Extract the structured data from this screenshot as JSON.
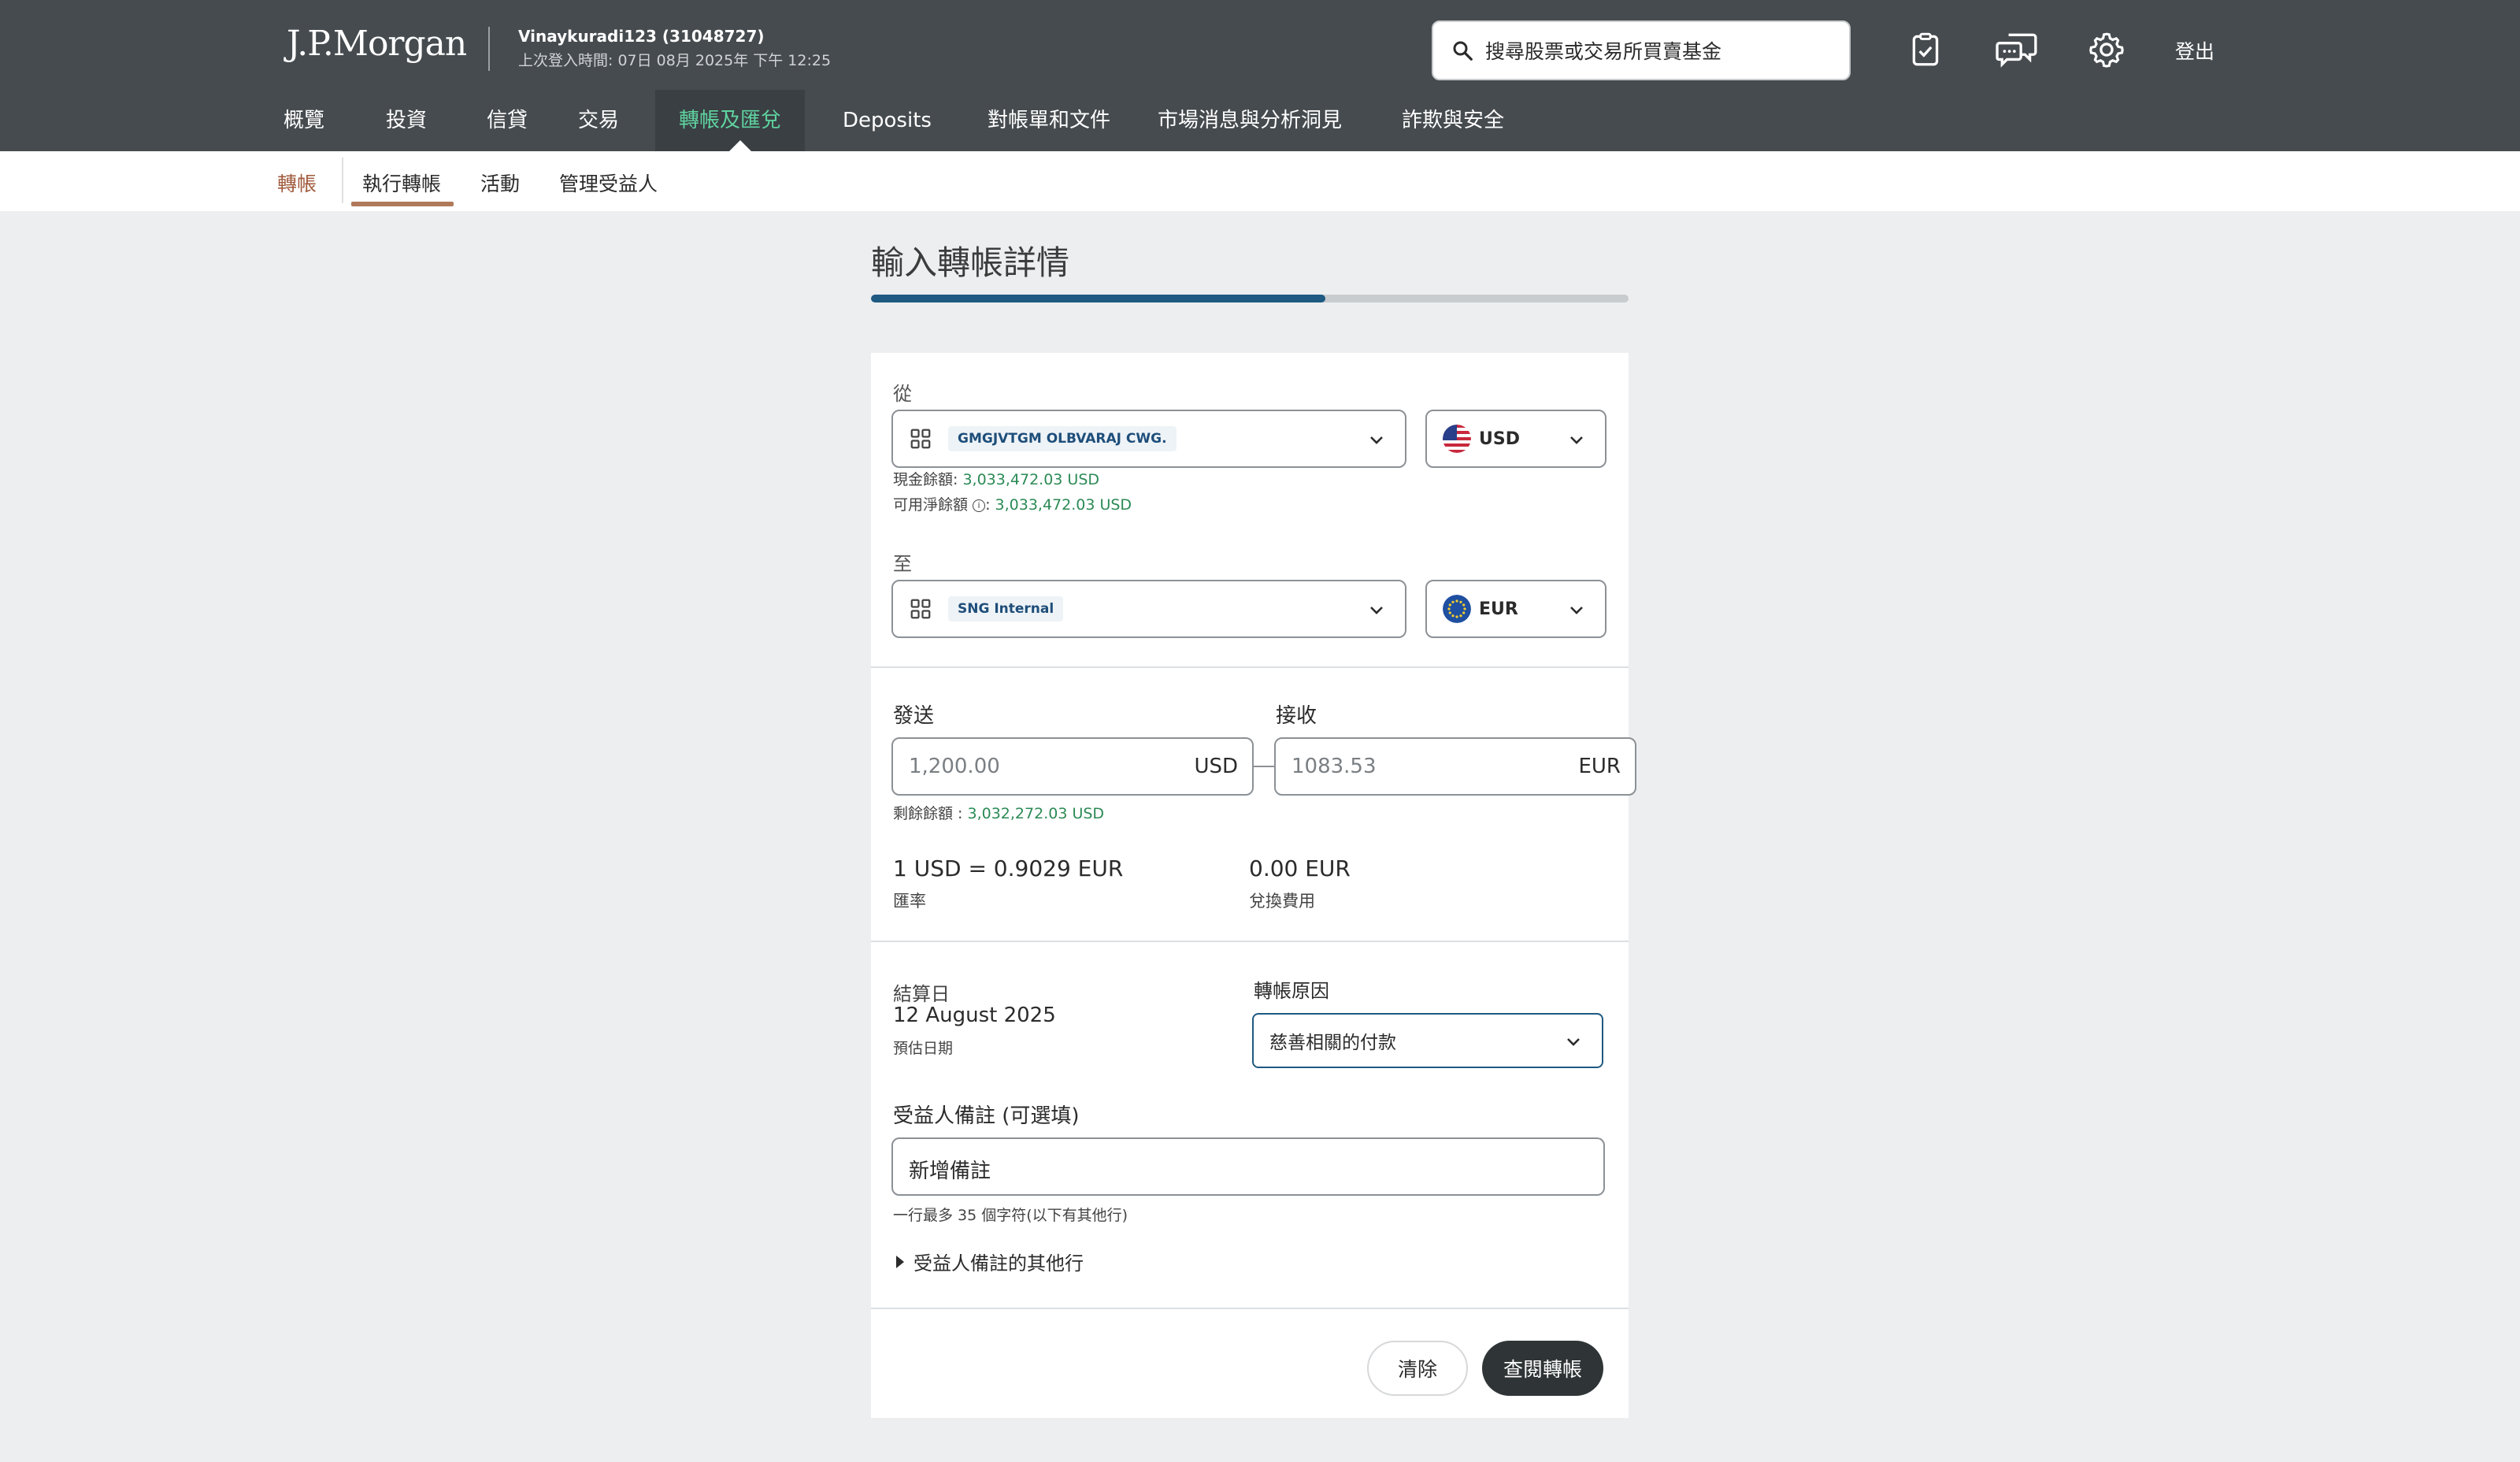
{
  "header": {
    "logo": "J.P.Morgan",
    "user_name": "Vinaykuradi123 (31048727)",
    "last_login": "上次登入時間: 07日 08月 2025年 下午 12:25",
    "search_placeholder": "搜尋股票或交易所買賣基金",
    "logout": "登出",
    "icons": [
      "clipboard-check-icon",
      "chat-icon",
      "gear-icon"
    ]
  },
  "nav": {
    "items": [
      "概覽",
      "投資",
      "信貸",
      "交易",
      "轉帳及匯兌",
      "Deposits",
      "對帳單和文件",
      "市場消息與分析洞見",
      "詐欺與安全"
    ],
    "active_index": 4
  },
  "subnav": {
    "items": [
      "轉帳",
      "執行轉帳",
      "活動",
      "管理受益人"
    ],
    "active_index": 1
  },
  "page": {
    "title": "輸入轉帳詳情",
    "progress_fraction": 0.6
  },
  "from": {
    "label": "從",
    "account": "GMGJVTGM OLBVARAJ CWG.",
    "currency": "USD",
    "cash_balance_label": "現金餘額:",
    "cash_balance": "3,033,472.03 USD",
    "available_label": "可用淨餘額",
    "available_balance": "3,033,472.03 USD"
  },
  "to": {
    "label": "至",
    "account": "SNG Internal",
    "currency": "EUR"
  },
  "amount": {
    "send_label": "發送",
    "send_value": "1,200.00",
    "send_currency": "USD",
    "receive_label": "接收",
    "receive_value": "1083.53",
    "receive_currency": "EUR",
    "remaining_label": "剩餘餘額 :",
    "remaining_value": "3,032,272.03 USD"
  },
  "rate": {
    "value": "1 USD = 0.9029 EUR",
    "label": "匯率",
    "fee_value": "0.00 EUR",
    "fee_label": "兌換費用"
  },
  "settlement": {
    "label": "結算日",
    "date": "12 August 2025",
    "note": "預估日期"
  },
  "reason": {
    "label": "轉帳原因",
    "value": "慈善相關的付款"
  },
  "beneficiary_note": {
    "label": "受益人備註 (可選填)",
    "value": "新增備註",
    "hint": "一行最多 35 個字符(以下有其他行)",
    "expander": "受益人備註的其他行"
  },
  "actions": {
    "clear": "清除",
    "review": "查閱轉帳"
  }
}
